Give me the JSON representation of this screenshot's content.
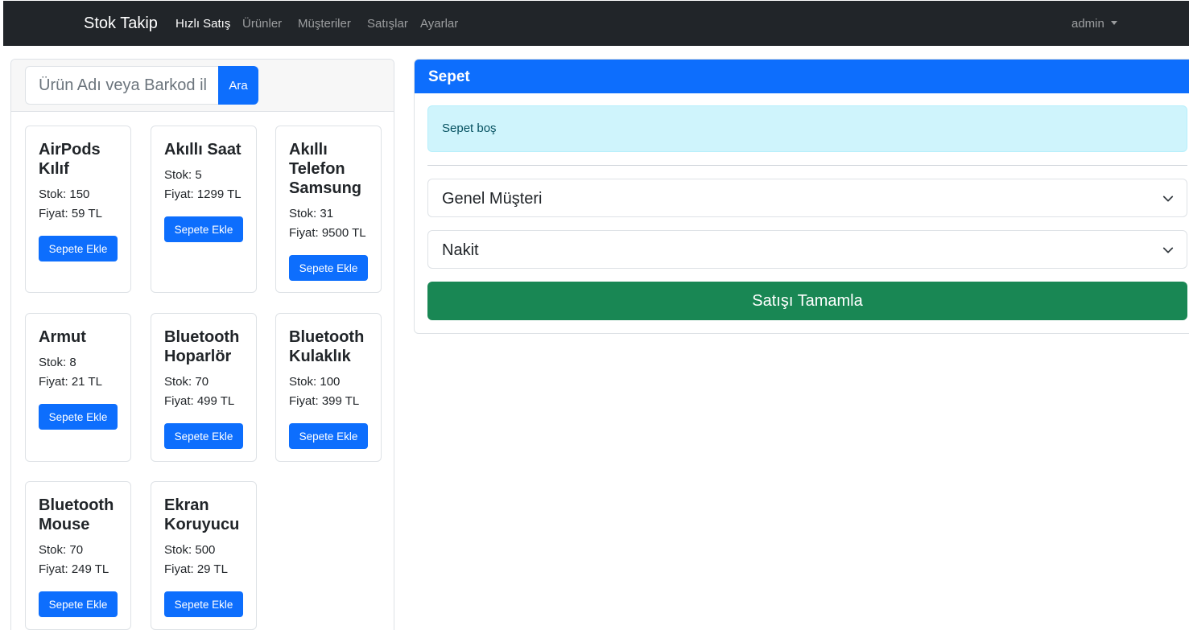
{
  "nav": {
    "brand": "Stok Takip",
    "links": [
      "Hızlı Satış",
      "Ürünler",
      "Müşteriler",
      "Satışlar",
      "Ayarlar"
    ],
    "user": "admin"
  },
  "search": {
    "placeholder": "Ürün Adı veya Barkod il",
    "button": "Ara"
  },
  "products": [
    {
      "name": "AirPods Kılıf",
      "stock": "Stok: 150",
      "price": "Fiyat: 59 TL",
      "button": "Sepete Ekle"
    },
    {
      "name": "Akıllı Saat",
      "stock": "Stok: 5",
      "price": "Fiyat: 1299 TL",
      "button": "Sepete Ekle"
    },
    {
      "name": "Akıllı Telefon Samsung",
      "stock": "Stok: 31",
      "price": "Fiyat: 9500 TL",
      "button": "Sepete Ekle"
    },
    {
      "name": "Armut",
      "stock": "Stok: 8",
      "price": "Fiyat: 21 TL",
      "button": "Sepete Ekle"
    },
    {
      "name": "Bluetooth Hoparlör",
      "stock": "Stok: 70",
      "price": "Fiyat: 499 TL",
      "button": "Sepete Ekle"
    },
    {
      "name": "Bluetooth Kulaklık",
      "stock": "Stok: 100",
      "price": "Fiyat: 399 TL",
      "button": "Sepete Ekle"
    },
    {
      "name": "Bluetooth Mouse",
      "stock": "Stok: 70",
      "price": "Fiyat: 249 TL",
      "button": "Sepete Ekle"
    },
    {
      "name": "Ekran Koruyucu",
      "stock": "Stok: 500",
      "price": "Fiyat: 29 TL",
      "button": "Sepete Ekle"
    }
  ],
  "cart": {
    "title": "Sepet",
    "empty_message": "Sepet boş",
    "customer_select": "Genel Müşteri",
    "payment_select": "Nakit",
    "complete_button": "Satışı Tamamla"
  },
  "colors": {
    "navbar": "#212529",
    "primary": "#0d6efd",
    "success": "#198754",
    "info_bg": "#cff4fc"
  },
  "icons": [
    "chevron-down-icon",
    "caret-down-icon"
  ]
}
